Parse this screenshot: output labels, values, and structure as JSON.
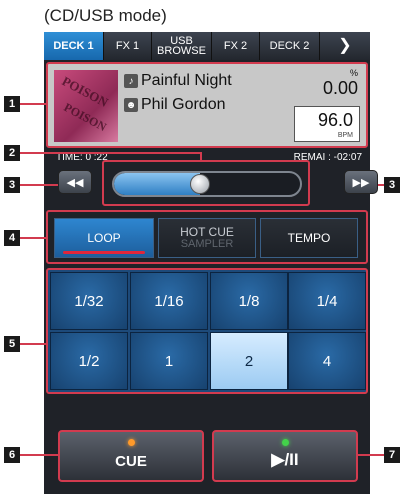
{
  "caption": "(CD/USB mode)",
  "tabs": [
    {
      "label": "DECK 1",
      "active": true
    },
    {
      "label": "FX 1",
      "active": false
    },
    {
      "label": "USB BROWSE",
      "active": false
    },
    {
      "label": "FX 2",
      "active": false
    },
    {
      "label": "DECK 2",
      "active": false
    }
  ],
  "tab_more_icon": "chevron-right-icon",
  "track": {
    "title": "Painful Night",
    "artist": "Phil Gordon",
    "title_icon": "music-note-icon",
    "artist_icon": "person-icon",
    "artwork_text": [
      "POISON",
      "POISON"
    ]
  },
  "pitch": {
    "value": "0.00",
    "unit": "%"
  },
  "bpm": {
    "value": "96.0",
    "unit": "BPM"
  },
  "time": {
    "elapsed": "TIME: 0  :22",
    "remain": "REMAI  : -02:07"
  },
  "seek": {
    "position": 0.46
  },
  "modes": {
    "loop": "LOOP",
    "hot_cue": "HOT CUE",
    "sampler": "SAMPLER",
    "tempo": "TEMPO"
  },
  "loop_values": [
    "1/32",
    "1/16",
    "1/8",
    "1/4",
    "1/2",
    "1",
    "2",
    "4"
  ],
  "loop_selected": "2",
  "buttons": {
    "cue": "CUE",
    "play": "▶/II"
  },
  "callouts": [
    "1",
    "2",
    "3",
    "3",
    "4",
    "5",
    "6",
    "7"
  ],
  "colors": {
    "accent": "#2f8fd6",
    "callout_line": "#d23b4f",
    "cue_led": "#ff9a2a",
    "play_led": "#43d24a"
  }
}
